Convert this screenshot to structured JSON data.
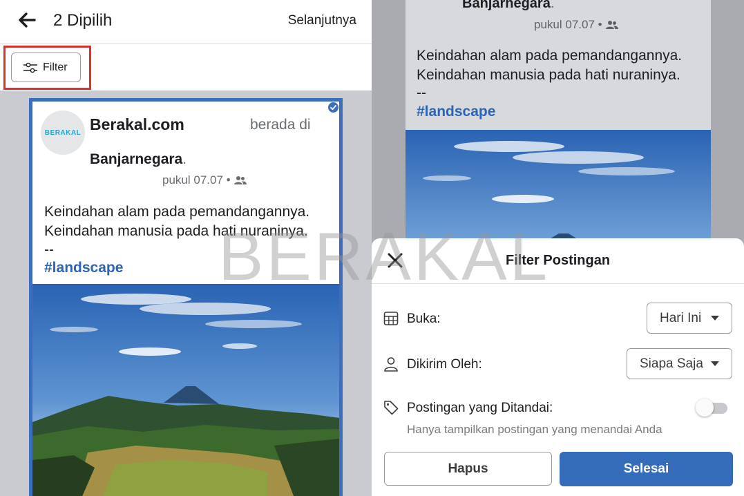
{
  "header": {
    "title": "2 Dipilih",
    "next_label": "Selanjutnya"
  },
  "filter_button": {
    "label": "Filter"
  },
  "post": {
    "avatar_text": "BERAKAL",
    "author": "Berakal.com",
    "location_prefix": "berada di",
    "place": "Banjarnegara",
    "place_suffix": ".",
    "time": "pukul 07.07 •",
    "audience_icon": "friends-icon",
    "body_line1": "Keindahan alam pada pemandangannya.",
    "body_line2": "Keindahan manusia pada hati nuraninya.",
    "dashes": "--",
    "hashtag": "#landscape",
    "selected": true
  },
  "watermark": "BERAKAL",
  "filter_sheet": {
    "title": "Filter Postingan",
    "open_label": "Buka:",
    "open_value": "Hari Ini",
    "sent_by_label": "Dikirim Oleh:",
    "sent_by_value": "Siapa Saja",
    "tagged_label": "Postingan yang Ditandai:",
    "tagged_hint": "Hanya tampilkan postingan yang menandai Anda",
    "tagged_enabled": false,
    "clear_label": "Hapus",
    "done_label": "Selesai"
  },
  "colors": {
    "accent": "#356cba",
    "selection_border": "#3b6fbd",
    "highlight_box": "#d9312b",
    "hashtag": "#2c64b6"
  }
}
